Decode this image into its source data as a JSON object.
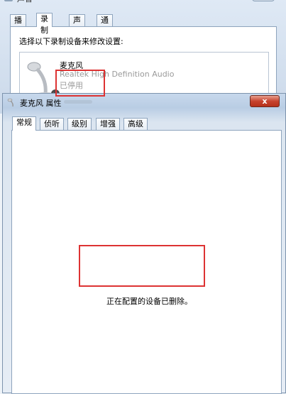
{
  "sound_window": {
    "title": "声音",
    "tabs": [
      "播放",
      "录制",
      "声音",
      "通信"
    ],
    "active_tab": 1,
    "instruction": "选择以下录制设备来修改设置:",
    "device": {
      "name": "麦克风",
      "driver": "Realtek High Definition Audio",
      "status": "已停用"
    }
  },
  "properties_window": {
    "title": "麦克风 属性",
    "close_label": "x",
    "tabs": [
      "常规",
      "侦听",
      "级别",
      "增强",
      "高级"
    ],
    "active_tab": 0,
    "message": "正在配置的设备已删除。"
  },
  "colors": {
    "highlight": "#d33333",
    "close_button": "#c7432e"
  }
}
